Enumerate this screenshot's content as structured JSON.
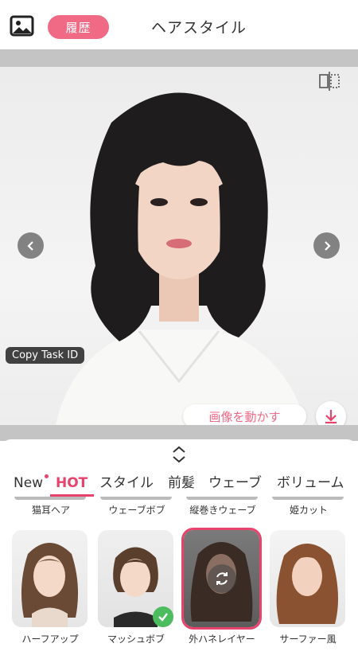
{
  "header": {
    "history_label": "履歴",
    "title": "ヘアスタイル",
    "gallery_icon": "image-gallery-icon"
  },
  "photo": {
    "compare_icon": "compare-split-icon",
    "copy_task_label": "Copy Task ID",
    "move_label": "画像を動かす",
    "download_icon": "download-icon",
    "prev_icon": "chevron-left-icon",
    "next_icon": "chevron-right-icon"
  },
  "panel": {
    "expand_icon": "expand-collapse-icon",
    "tabs": [
      {
        "label": "New"
      },
      {
        "label": "HOT"
      },
      {
        "label": "スタイル"
      },
      {
        "label": "前髪"
      },
      {
        "label": "ウェーブ"
      },
      {
        "label": "ボリューム"
      }
    ],
    "active_tab": "HOT",
    "top_row_labels": [
      "猫耳ヘア",
      "ウェーブボブ",
      "縦巻きウェーブ",
      "姫カット"
    ],
    "cards": [
      {
        "label": "ハーフアップ"
      },
      {
        "label": "マッシュボブ",
        "badge": "check-icon"
      },
      {
        "label": "外ハネレイヤー",
        "badge": "refresh-icon",
        "selected": true
      },
      {
        "label": "サーファー風"
      }
    ]
  },
  "colors": {
    "accent": "#e8436c",
    "history_button": "#f06a86",
    "check_badge": "#4cbc5e"
  }
}
